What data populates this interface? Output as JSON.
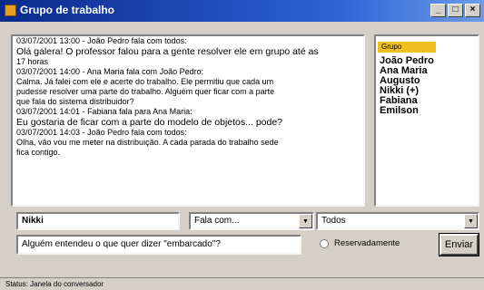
{
  "window": {
    "title": "Grupo de trabalho",
    "buttons": {
      "minimize": "_",
      "maximize": "□",
      "close": "×"
    }
  },
  "chat": {
    "lines": [
      {
        "text": "03/07/2001 13:00 - João Pedro fala com todos:",
        "big": false
      },
      {
        "text": "Olá galera! O professor falou para a gente resolver ele em grupo até as",
        "big": true
      },
      {
        "text": "17 horas",
        "big": false
      },
      {
        "text": "03/07/2001 14:00 - Ana Maria fala com João Pedro:",
        "big": false
      },
      {
        "text": "Calma. Já falei com ele e acerte do trabalho. Ele permitiu que cada um",
        "big": false
      },
      {
        "text": "pudesse resolver uma parte do trabalho. Alguém quer ficar com a parte",
        "big": false
      },
      {
        "text": "que fala do sistema distribuidor?",
        "big": false
      },
      {
        "text": "03/07/2001 14:01 - Fabiana fala para Ana Maria:",
        "big": false
      },
      {
        "text": "Eu gostaria de ficar com a parte do modelo de objetos... pode?",
        "big": true
      },
      {
        "text": "03/07/2001 14:03 - João Pedro fala com todos:",
        "big": false
      },
      {
        "text": "Olha, vão vou me meter na distribuição. A cada parada do trabalho sede",
        "big": false
      },
      {
        "text": "fica contigo.",
        "big": false
      }
    ]
  },
  "members": {
    "group_label": "Grupo",
    "names": [
      "João Pedro",
      "Ana Maria",
      "Augusto",
      "Nikki (+)",
      "Fabiana",
      "Emilson"
    ]
  },
  "composer": {
    "nickname": "Nikki",
    "speech_mode": "Fala com...",
    "recipient": "Todos",
    "message": "Alguém entendeu o que quer dizer \"embarcado\"?",
    "private_label": "Reservadamente",
    "send_label": "Enviar"
  },
  "status": {
    "text": "Status: Janela do conversador"
  }
}
